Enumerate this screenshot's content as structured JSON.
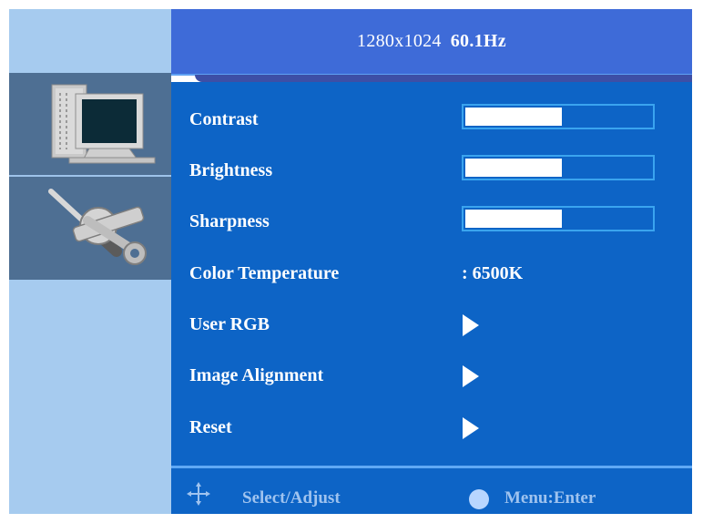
{
  "header": {
    "resolution": "1280x1024",
    "refresh": "60.1Hz"
  },
  "sidebar": {
    "items": [
      {
        "icon": "monitor-icon",
        "selected": true
      },
      {
        "icon": "tools-icon",
        "selected": false
      }
    ]
  },
  "menu": {
    "contrast": {
      "label": "Contrast",
      "level": 0.52
    },
    "brightness": {
      "label": "Brightness",
      "level": 0.52
    },
    "sharpness": {
      "label": "Sharpness",
      "level": 0.52
    },
    "color_temperature": {
      "label": "Color Temperature",
      "value": ": 6500K"
    },
    "user_rgb": {
      "label": "User RGB"
    },
    "image_alignment": {
      "label": "Image Alignment"
    },
    "reset": {
      "label": "Reset"
    }
  },
  "footer": {
    "select_adjust": "Select/Adjust",
    "menu_enter": "Menu:Enter"
  },
  "colors": {
    "main_bg": "#0d64c6",
    "header_bg": "#3e6bd8",
    "sidebar_bg": "#a6cbef",
    "sidebar_selected_bg": "#4e6f93",
    "bar_border": "#3aa4ef",
    "footer_text": "#9fc3ef"
  }
}
